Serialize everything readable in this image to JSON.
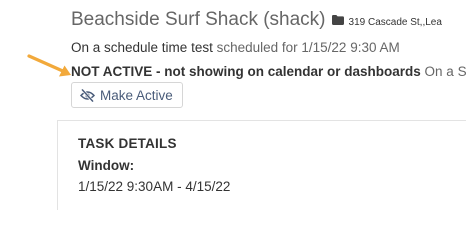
{
  "header": {
    "title": "Beachside Surf Shack (shack)",
    "address": "319 Cascade St,,Lea",
    "folder_icon": "folder-icon"
  },
  "schedule": {
    "name": "On a schedule time test",
    "scheduled_text": "scheduled for 1/15/22 9:30 AM"
  },
  "status": {
    "not_active_text": "NOT ACTIVE - not showing on calendar or dashboards",
    "trailing_text": "On a S"
  },
  "make_active_button": {
    "label": "Make Active",
    "icon": "eye-slash-icon"
  },
  "annotation": {
    "icon": "arrow-icon",
    "color": "#f2a93b"
  },
  "task_details": {
    "heading": "TASK DETAILS",
    "window_label": "Window:",
    "window_value": "1/15/22 9:30AM - 4/15/22"
  },
  "colors": {
    "title": "#666666",
    "text": "#333333",
    "button_text": "#4a5c7a",
    "border": "#d6d6d6"
  }
}
